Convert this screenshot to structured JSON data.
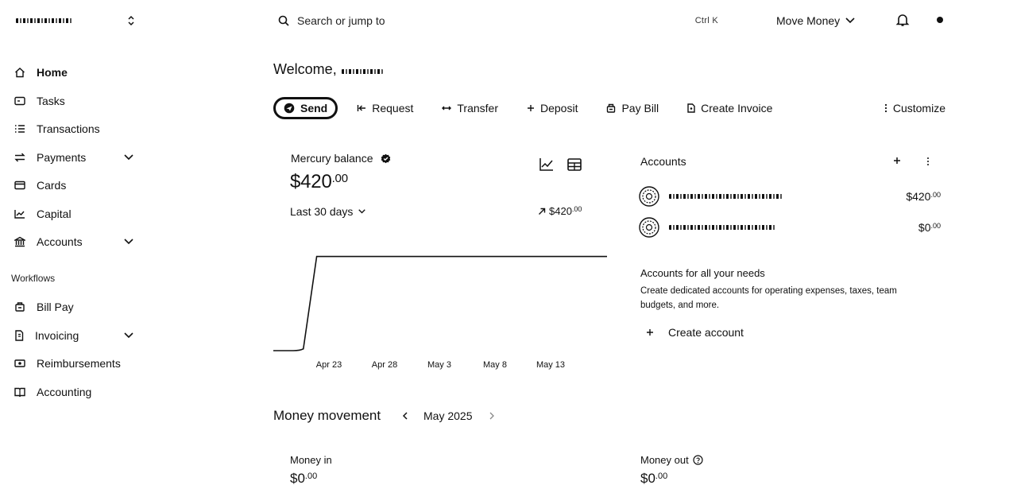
{
  "topbar": {
    "org_name": "",
    "search_placeholder": "Search or jump to",
    "shortcut": "Ctrl K",
    "move_money": "Move Money"
  },
  "sidebar": {
    "items": [
      {
        "label": "Home",
        "icon": "home-icon"
      },
      {
        "label": "Tasks",
        "icon": "tasks-icon"
      },
      {
        "label": "Transactions",
        "icon": "list-icon"
      },
      {
        "label": "Payments",
        "icon": "arrows-icon"
      },
      {
        "label": "Cards",
        "icon": "card-icon"
      },
      {
        "label": "Capital",
        "icon": "chart-icon"
      },
      {
        "label": "Accounts",
        "icon": "bank-icon"
      }
    ],
    "workflows_heading": "Workflows",
    "workflows": [
      {
        "label": "Bill Pay",
        "icon": "bill-icon"
      },
      {
        "label": "Invoicing",
        "icon": "invoice-icon"
      },
      {
        "label": "Reimbursements",
        "icon": "cash-icon"
      },
      {
        "label": "Accounting",
        "icon": "book-icon"
      }
    ]
  },
  "main": {
    "welcome": "Welcome,",
    "actions": {
      "send": "Send",
      "request": "Request",
      "transfer": "Transfer",
      "deposit": "Deposit",
      "pay_bill": "Pay Bill",
      "create_invoice": "Create Invoice",
      "customize": "Customize"
    },
    "balance": {
      "label": "Mercury balance",
      "whole": "$420",
      "cents": ".00",
      "period": "Last 30 days",
      "change_whole": "$420",
      "change_cents": ".00"
    }
  },
  "chart_data": {
    "type": "line",
    "x_ticks": [
      "Apr 23",
      "Apr 28",
      "May 3",
      "May 8",
      "May 13"
    ],
    "series": [
      {
        "points": [
          [
            0,
            0
          ],
          [
            0.06,
            0
          ],
          [
            0.09,
            8
          ],
          [
            0.13,
            420
          ],
          [
            1.0,
            420
          ]
        ]
      }
    ],
    "ylim": [
      0,
      500
    ],
    "grid": false
  },
  "accounts": {
    "title": "Accounts",
    "rows": [
      {
        "amount_whole": "$420",
        "amount_cents": ".00"
      },
      {
        "amount_whole": "$0",
        "amount_cents": ".00"
      }
    ],
    "promo_title": "Accounts for all your needs",
    "promo_desc": "Create dedicated accounts for operating expenses, taxes, team budgets, and more.",
    "create": "Create account"
  },
  "money_movement": {
    "title": "Money movement",
    "month": "May 2025",
    "in_label": "Money in",
    "in_whole": "$0",
    "in_cents": ".00",
    "out_label": "Money out",
    "out_whole": "$0",
    "out_cents": ".00"
  }
}
